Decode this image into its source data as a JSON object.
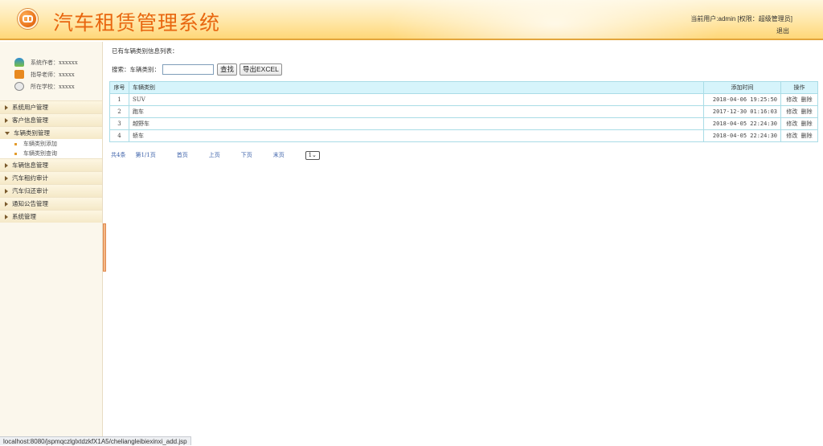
{
  "header": {
    "app_title": "汽车租赁管理系统",
    "user_info": "当前用户:admin [权限：超级管理员]",
    "logout_label": "退出"
  },
  "sidebar": {
    "info": [
      {
        "icon": "user-group-icon",
        "text": "系统作者：xxxxxx"
      },
      {
        "icon": "teacher-icon",
        "text": "指导老师：xxxxx"
      },
      {
        "icon": "school-icon",
        "text": "所在学校：xxxxx"
      }
    ],
    "menu": [
      {
        "label": "系统用户管理",
        "open": false
      },
      {
        "label": "客户信息管理",
        "open": false
      },
      {
        "label": "车辆类别管理",
        "open": true,
        "children": [
          "车辆类别添加",
          "车辆类别查询"
        ]
      },
      {
        "label": "车辆信息管理",
        "open": false
      },
      {
        "label": "汽车租约审计",
        "open": false
      },
      {
        "label": "汽车归还审计",
        "open": false
      },
      {
        "label": "通知公告管理",
        "open": false
      },
      {
        "label": "系统管理",
        "open": false
      }
    ]
  },
  "main": {
    "list_title": "已有车辆类别信息列表：",
    "search": {
      "label": "搜索：车辆类别：",
      "value": "",
      "placeholder": ""
    },
    "search_button": "查找",
    "export_button": "导出EXCEL",
    "table": {
      "columns": [
        "序号",
        "车辆类别",
        "添加时间",
        "操作"
      ],
      "rows": [
        {
          "idx": "1",
          "category": "SUV",
          "time": "2018-04-06 19:25:50",
          "edit": "修改",
          "delete": "删除"
        },
        {
          "idx": "2",
          "category": "跑车",
          "time": "2017-12-30 01:16:03",
          "edit": "修改",
          "delete": "删除"
        },
        {
          "idx": "3",
          "category": "越野车",
          "time": "2018-04-05 22:24:30",
          "edit": "修改",
          "delete": "删除"
        },
        {
          "idx": "4",
          "category": "轿车",
          "time": "2018-04-05 22:24:30",
          "edit": "修改",
          "delete": "删除"
        }
      ]
    },
    "pager": {
      "total": "共4条",
      "page_info": "第1/1页",
      "first": "首页",
      "prev": "上页",
      "next": "下页",
      "last": "末页",
      "selected_page": "1"
    }
  },
  "statusbar": {
    "url": "localhost:8080/jspmqczlglxtdzkfX1A5/cheliangleibiexinxi_add.jsp"
  },
  "colors": {
    "title_orange": "#e8660f",
    "header_bar": "#ffd778",
    "table_header_bg": "#d6f4fb",
    "pager_link": "#3a5fa8"
  }
}
